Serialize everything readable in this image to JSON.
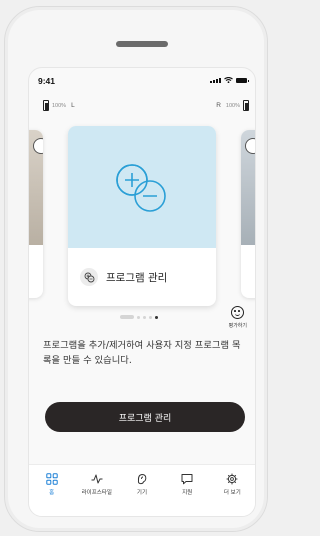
{
  "status": {
    "time": "9:41"
  },
  "hearing_aids": {
    "left": {
      "percent": "100%",
      "side": "L"
    },
    "right": {
      "side": "R",
      "percent": "100%"
    }
  },
  "carousel": {
    "card_title": "프로그램 관리",
    "pages": 5,
    "active_page": 5
  },
  "rate_label": "평가하기",
  "description": "프로그램을 추가/제거하여 사용자 지정 프로그램 목록을 만들 수 있습니다.",
  "cta_label": "프로그램 관리",
  "tabs": [
    {
      "label": "홈",
      "icon": "home-grid-icon",
      "active": true
    },
    {
      "label": "라이프스타일",
      "icon": "lifestyle-pulse-icon",
      "active": false
    },
    {
      "label": "기기",
      "icon": "device-ear-icon",
      "active": false
    },
    {
      "label": "지원",
      "icon": "chat-bubble-icon",
      "active": false
    },
    {
      "label": "더 보기",
      "icon": "gear-icon",
      "active": false
    }
  ],
  "colors": {
    "accent": "#1a7fd6",
    "card_image_bg": "#cfe8f3",
    "cta_bg": "#2a2626"
  }
}
